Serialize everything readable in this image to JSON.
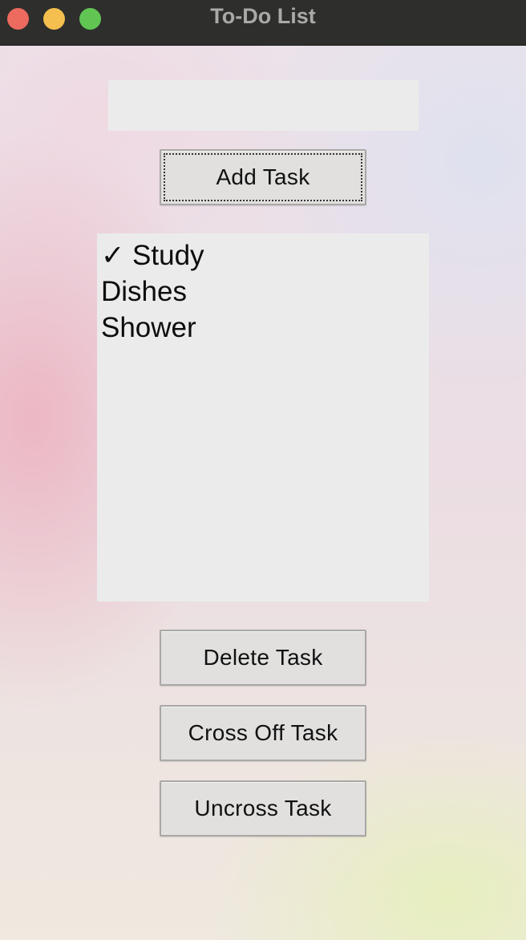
{
  "window": {
    "title": "To-Do List",
    "controls": {
      "close_color": "#ec6a5e",
      "minimize_color": "#f4bf4f",
      "zoom_color": "#61c554"
    }
  },
  "task_input": {
    "value": "",
    "placeholder": ""
  },
  "buttons": {
    "add": "Add Task",
    "delete": "Delete Task",
    "cross_off": "Cross Off Task",
    "uncross": "Uncross Task"
  },
  "tasks": [
    {
      "label": "✓ Study",
      "crossed": true
    },
    {
      "label": "Dishes",
      "crossed": false
    },
    {
      "label": "Shower",
      "crossed": false
    }
  ]
}
